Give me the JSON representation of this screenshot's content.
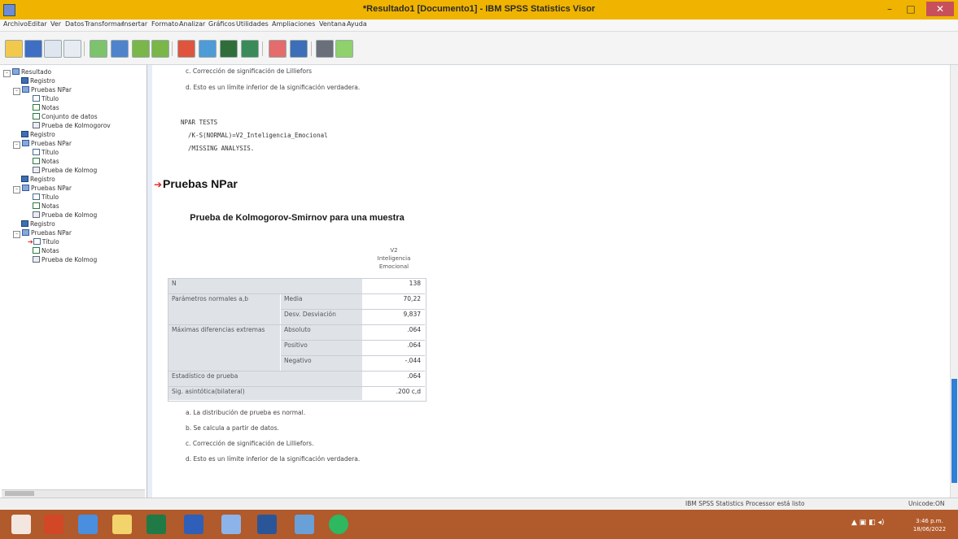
{
  "window": {
    "title": "*Resultado1 [Documento1] - IBM SPSS Statistics Visor",
    "minimize": "–",
    "maximize": "□",
    "close": "✕"
  },
  "menu": [
    "Archivo",
    "Editar",
    "Ver",
    "Datos",
    "Transformar",
    "Insertar",
    "Formato",
    "Analizar",
    "Gráficos",
    "Utilidades",
    "Ampliaciones",
    "Ventana",
    "Ayuda"
  ],
  "tree": {
    "items": [
      {
        "label": "Resultado"
      },
      {
        "label": "Registro"
      },
      {
        "label": "Pruebas NPar"
      },
      {
        "label": "Título"
      },
      {
        "label": "Notas"
      },
      {
        "label": "Conjunto de datos"
      },
      {
        "label": "Prueba de Kolmogorov"
      },
      {
        "label": "Registro"
      },
      {
        "label": "Pruebas NPar"
      },
      {
        "label": "Título"
      },
      {
        "label": "Notas"
      },
      {
        "label": "Prueba de Kolmog"
      },
      {
        "label": "Registro"
      },
      {
        "label": "Pruebas NPar"
      },
      {
        "label": "Título"
      },
      {
        "label": "Notas"
      },
      {
        "label": "Prueba de Kolmog"
      },
      {
        "label": "Registro"
      },
      {
        "label": "Pruebas NPar"
      },
      {
        "label": "Título"
      },
      {
        "label": "Notas"
      },
      {
        "label": "Prueba de Kolmog"
      }
    ]
  },
  "content": {
    "prev_foot_c": "c. Corrección de significación de Lilliefors",
    "prev_foot_d": "d. Esto es un límite inferior de la significación verdadera.",
    "syntax": [
      "NPAR TESTS",
      "  /K-S(NORMAL)=V2_Inteligencia_Emocional",
      "  /MISSING ANALYSIS."
    ],
    "heading": "Pruebas NPar",
    "table": {
      "title": "Prueba de Kolmogorov-Smirnov para una muestra",
      "col_header": [
        "V2",
        "Inteligencia",
        "Emocional"
      ],
      "rows": [
        {
          "label": "N",
          "sub": "",
          "value": "138"
        },
        {
          "label": "Parámetros normales a,b",
          "sub": "Media",
          "value": "70,22"
        },
        {
          "label": "",
          "sub": "Desv. Desviación",
          "value": "9,837"
        },
        {
          "label": "Máximas diferencias extremas",
          "sub": "Absoluto",
          "value": ".064"
        },
        {
          "label": "",
          "sub": "Positivo",
          "value": ".064"
        },
        {
          "label": "",
          "sub": "Negativo",
          "value": "-.044"
        },
        {
          "label": "Estadístico de prueba",
          "sub": "",
          "value": ".064"
        },
        {
          "label": "Sig. asintótica(bilateral)",
          "sub": "",
          "value": ".200 c,d"
        }
      ]
    },
    "footnotes": [
      "a. La distribución de prueba es normal.",
      "b. Se calcula a partir de datos.",
      "c. Corrección de significación de Lilliefors.",
      "d. Esto es un límite inferior de la significación verdadera."
    ]
  },
  "statusbar": {
    "processor": "IBM SPSS Statistics Processor está listo",
    "unicode": "Unicode:ON"
  },
  "taskbar": {
    "apps": [
      "start",
      "powerpoint",
      "chrome",
      "file-explorer",
      "excel",
      "headset",
      "notepad",
      "word",
      "browser",
      "whatsapp"
    ],
    "time": "3:46 p.m.",
    "date": "18/06/2022"
  },
  "colors": {
    "titlebar": "#f0b400",
    "taskbar": "#b15a2b",
    "accent": "#2f7fd6",
    "heading_arrow": "#e02020"
  }
}
